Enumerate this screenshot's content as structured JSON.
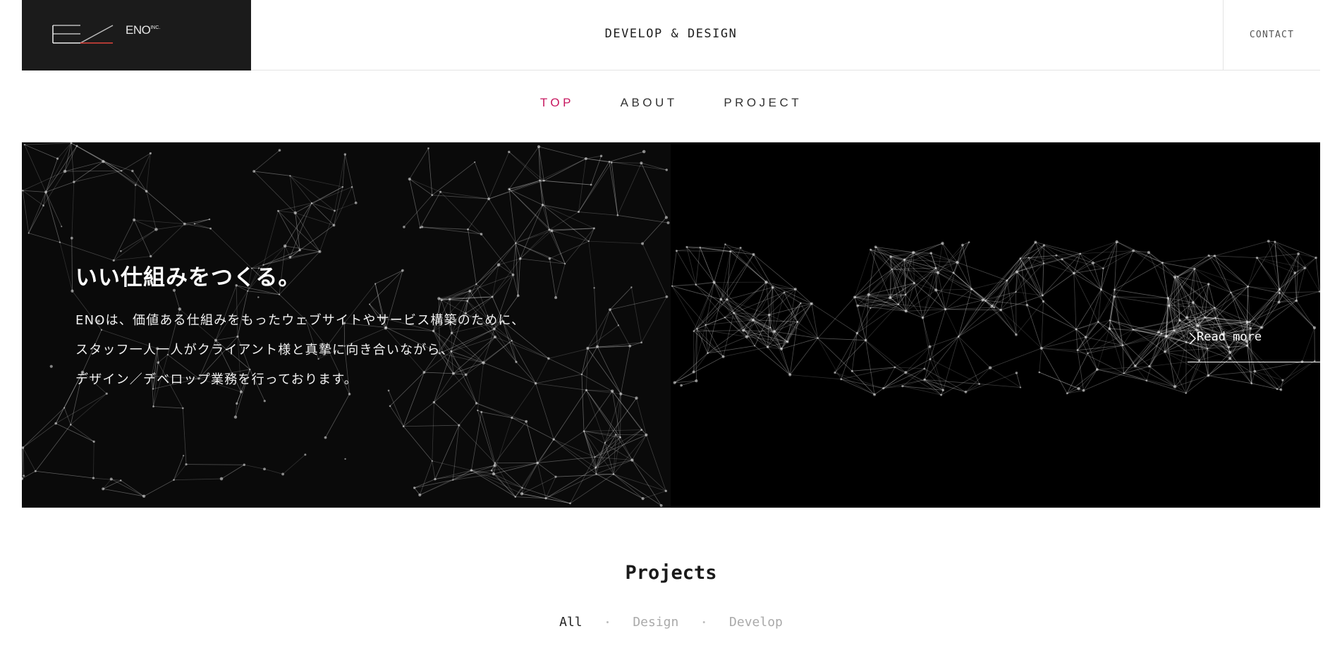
{
  "header": {
    "logo_name": "ENO",
    "logo_suffix": "INC.",
    "tagline": "DEVELOP & DESIGN",
    "contact_label": "CONTACT"
  },
  "nav": {
    "items": [
      {
        "label": "TOP",
        "active": true
      },
      {
        "label": "ABOUT",
        "active": false
      },
      {
        "label": "PROJECT",
        "active": false
      }
    ],
    "active_color": "#c7175f"
  },
  "hero": {
    "title": "いい仕組みをつくる。",
    "lines": [
      "ENOは、価値ある仕組みをもったウェブサイトやサービス構築のために、",
      "スタッフ一人一人がクライアント様と真摯に向き合いながら、",
      "デザイン／デベロップ業務を行っております。"
    ],
    "read_more": "Read more"
  },
  "projects": {
    "title": "Projects",
    "filters": [
      {
        "label": "All",
        "active": true
      },
      {
        "label": "Design",
        "active": false
      },
      {
        "label": "Develop",
        "active": false
      }
    ],
    "separator": "・"
  }
}
